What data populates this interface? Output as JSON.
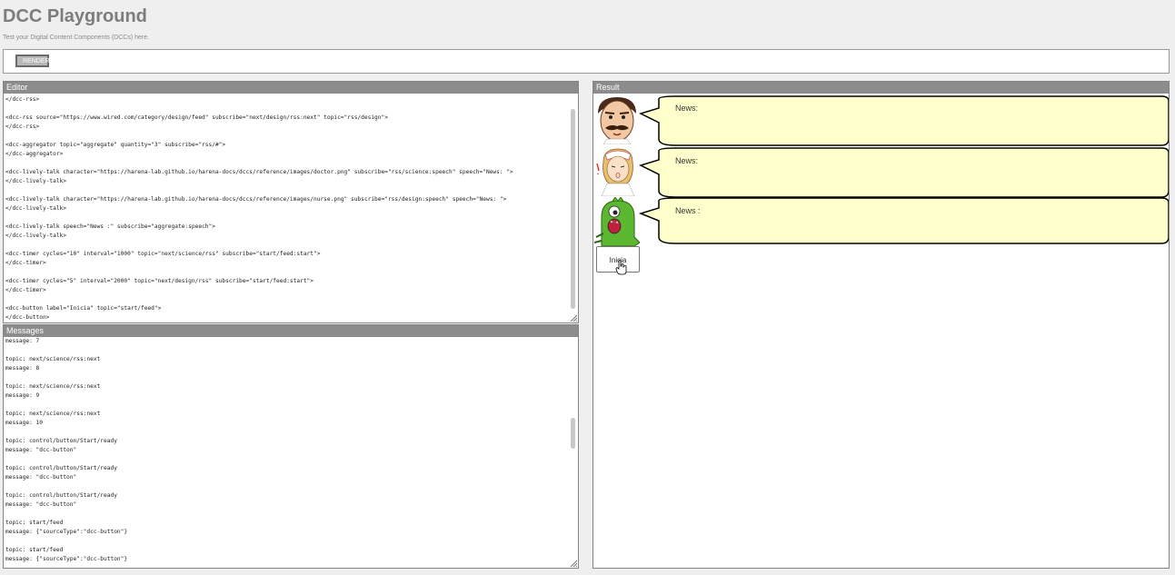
{
  "app": {
    "title": "DCC Playground",
    "subtitle": "Test your Digital Content Components (DCCs) here."
  },
  "toolbar": {
    "render_label": "RENDER"
  },
  "editor": {
    "title": "Editor",
    "lines": [
      "</dcc-rss>",
      "",
      "<dcc-rss source=\"https://www.wired.com/category/design/feed\" subscribe=\"next/design/rss:next\" topic=\"rss/design\">",
      "</dcc-rss>",
      "",
      "<dcc-aggregator topic=\"aggregate\" quantity=\"3\" subscribe=\"rss/#\">",
      "</dcc-aggregator>",
      "",
      "<dcc-lively-talk character=\"https://harena-lab.github.io/harena-docs/dccs/reference/images/doctor.png\" subscribe=\"rss/science:speech\" speech=\"News: \">",
      "</dcc-lively-talk>",
      "",
      "<dcc-lively-talk character=\"https://harena-lab.github.io/harena-docs/dccs/reference/images/nurse.png\" subscribe=\"rss/design:speech\" speech=\"News: \">",
      "</dcc-lively-talk>",
      "",
      "<dcc-lively-talk speech=\"News :\" subscribe=\"aggregate:speech\">",
      "</dcc-lively-talk>",
      "",
      "<dcc-timer cycles=\"10\" interval=\"1000\" topic=\"next/science/rss\" subscribe=\"start/feed:start\">",
      "</dcc-timer>",
      "",
      "<dcc-timer cycles=\"5\" interval=\"2000\" topic=\"next/design/rss\" subscribe=\"start/feed:start\">",
      "</dcc-timer>",
      "",
      "<dcc-button label=\"Inicia\" topic=\"start/feed\">",
      "</dcc-button>"
    ]
  },
  "messages": {
    "title": "Messages",
    "lines": [
      "message: 7",
      "",
      "topic: next/science/rss:next",
      "message: 8",
      "",
      "topic: next/science/rss:next",
      "message: 9",
      "",
      "topic: next/science/rss:next",
      "message: 10",
      "",
      "topic: control/button/Start/ready",
      "message: \"dcc-button\"",
      "",
      "topic: control/button/Start/ready",
      "message: \"dcc-button\"",
      "",
      "topic: control/button/Start/ready",
      "message: \"dcc-button\"",
      "",
      "topic: start/feed",
      "message: {\"sourceType\":\"dcc-button\"}",
      "",
      "topic: start/feed",
      "message: {\"sourceType\":\"dcc-button\"}"
    ]
  },
  "result": {
    "title": "Result",
    "talks": [
      {
        "character": "doctor",
        "speech": "News:"
      },
      {
        "character": "nurse",
        "speech": "News:"
      },
      {
        "character": "monster",
        "speech": "News :"
      }
    ],
    "button_label": "Inicia"
  }
}
